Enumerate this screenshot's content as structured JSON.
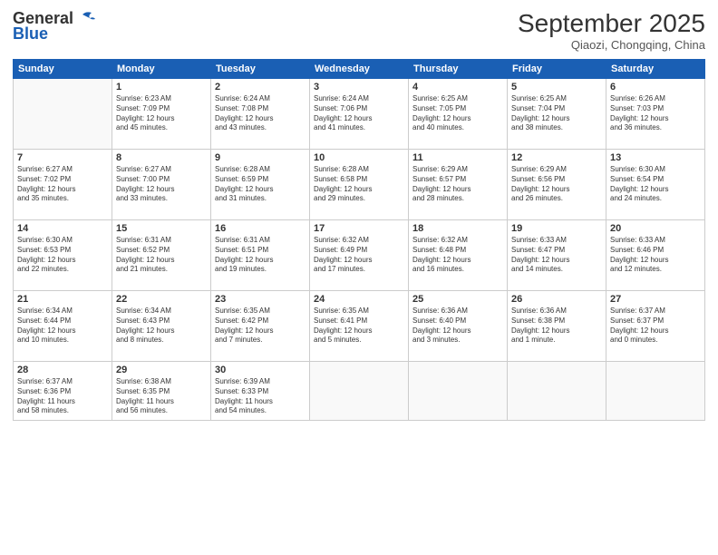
{
  "header": {
    "logo_line1": "General",
    "logo_line2": "Blue",
    "month": "September 2025",
    "location": "Qiaozi, Chongqing, China"
  },
  "days_of_week": [
    "Sunday",
    "Monday",
    "Tuesday",
    "Wednesday",
    "Thursday",
    "Friday",
    "Saturday"
  ],
  "weeks": [
    [
      {
        "day": "",
        "info": ""
      },
      {
        "day": "1",
        "info": "Sunrise: 6:23 AM\nSunset: 7:09 PM\nDaylight: 12 hours\nand 45 minutes."
      },
      {
        "day": "2",
        "info": "Sunrise: 6:24 AM\nSunset: 7:08 PM\nDaylight: 12 hours\nand 43 minutes."
      },
      {
        "day": "3",
        "info": "Sunrise: 6:24 AM\nSunset: 7:06 PM\nDaylight: 12 hours\nand 41 minutes."
      },
      {
        "day": "4",
        "info": "Sunrise: 6:25 AM\nSunset: 7:05 PM\nDaylight: 12 hours\nand 40 minutes."
      },
      {
        "day": "5",
        "info": "Sunrise: 6:25 AM\nSunset: 7:04 PM\nDaylight: 12 hours\nand 38 minutes."
      },
      {
        "day": "6",
        "info": "Sunrise: 6:26 AM\nSunset: 7:03 PM\nDaylight: 12 hours\nand 36 minutes."
      }
    ],
    [
      {
        "day": "7",
        "info": "Sunrise: 6:27 AM\nSunset: 7:02 PM\nDaylight: 12 hours\nand 35 minutes."
      },
      {
        "day": "8",
        "info": "Sunrise: 6:27 AM\nSunset: 7:00 PM\nDaylight: 12 hours\nand 33 minutes."
      },
      {
        "day": "9",
        "info": "Sunrise: 6:28 AM\nSunset: 6:59 PM\nDaylight: 12 hours\nand 31 minutes."
      },
      {
        "day": "10",
        "info": "Sunrise: 6:28 AM\nSunset: 6:58 PM\nDaylight: 12 hours\nand 29 minutes."
      },
      {
        "day": "11",
        "info": "Sunrise: 6:29 AM\nSunset: 6:57 PM\nDaylight: 12 hours\nand 28 minutes."
      },
      {
        "day": "12",
        "info": "Sunrise: 6:29 AM\nSunset: 6:56 PM\nDaylight: 12 hours\nand 26 minutes."
      },
      {
        "day": "13",
        "info": "Sunrise: 6:30 AM\nSunset: 6:54 PM\nDaylight: 12 hours\nand 24 minutes."
      }
    ],
    [
      {
        "day": "14",
        "info": "Sunrise: 6:30 AM\nSunset: 6:53 PM\nDaylight: 12 hours\nand 22 minutes."
      },
      {
        "day": "15",
        "info": "Sunrise: 6:31 AM\nSunset: 6:52 PM\nDaylight: 12 hours\nand 21 minutes."
      },
      {
        "day": "16",
        "info": "Sunrise: 6:31 AM\nSunset: 6:51 PM\nDaylight: 12 hours\nand 19 minutes."
      },
      {
        "day": "17",
        "info": "Sunrise: 6:32 AM\nSunset: 6:49 PM\nDaylight: 12 hours\nand 17 minutes."
      },
      {
        "day": "18",
        "info": "Sunrise: 6:32 AM\nSunset: 6:48 PM\nDaylight: 12 hours\nand 16 minutes."
      },
      {
        "day": "19",
        "info": "Sunrise: 6:33 AM\nSunset: 6:47 PM\nDaylight: 12 hours\nand 14 minutes."
      },
      {
        "day": "20",
        "info": "Sunrise: 6:33 AM\nSunset: 6:46 PM\nDaylight: 12 hours\nand 12 minutes."
      }
    ],
    [
      {
        "day": "21",
        "info": "Sunrise: 6:34 AM\nSunset: 6:44 PM\nDaylight: 12 hours\nand 10 minutes."
      },
      {
        "day": "22",
        "info": "Sunrise: 6:34 AM\nSunset: 6:43 PM\nDaylight: 12 hours\nand 8 minutes."
      },
      {
        "day": "23",
        "info": "Sunrise: 6:35 AM\nSunset: 6:42 PM\nDaylight: 12 hours\nand 7 minutes."
      },
      {
        "day": "24",
        "info": "Sunrise: 6:35 AM\nSunset: 6:41 PM\nDaylight: 12 hours\nand 5 minutes."
      },
      {
        "day": "25",
        "info": "Sunrise: 6:36 AM\nSunset: 6:40 PM\nDaylight: 12 hours\nand 3 minutes."
      },
      {
        "day": "26",
        "info": "Sunrise: 6:36 AM\nSunset: 6:38 PM\nDaylight: 12 hours\nand 1 minute."
      },
      {
        "day": "27",
        "info": "Sunrise: 6:37 AM\nSunset: 6:37 PM\nDaylight: 12 hours\nand 0 minutes."
      }
    ],
    [
      {
        "day": "28",
        "info": "Sunrise: 6:37 AM\nSunset: 6:36 PM\nDaylight: 11 hours\nand 58 minutes."
      },
      {
        "day": "29",
        "info": "Sunrise: 6:38 AM\nSunset: 6:35 PM\nDaylight: 11 hours\nand 56 minutes."
      },
      {
        "day": "30",
        "info": "Sunrise: 6:39 AM\nSunset: 6:33 PM\nDaylight: 11 hours\nand 54 minutes."
      },
      {
        "day": "",
        "info": ""
      },
      {
        "day": "",
        "info": ""
      },
      {
        "day": "",
        "info": ""
      },
      {
        "day": "",
        "info": ""
      }
    ]
  ]
}
